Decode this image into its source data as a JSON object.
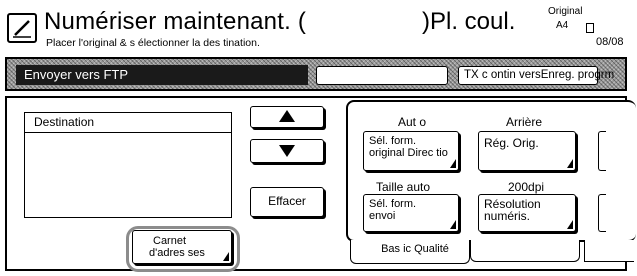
{
  "header": {
    "title": "Numériser maintenant. (",
    "subtitle": "Placer l'original & s électionner la des tination.",
    "title_right": ")Pl. coul.",
    "original_label": "Original",
    "original_size": "A4",
    "date": "08/08"
  },
  "bar": {
    "send_to": "Envoyer vers FTP",
    "right_button": "TX c ontin versEnreg. progrm"
  },
  "destination": {
    "label": "Destination"
  },
  "buttons": {
    "effacer": "Effacer",
    "carnet_line1": "Carnet",
    "carnet_line2": "d'adres ses"
  },
  "settings": {
    "auto_label": "Aut o",
    "arriere_label": "Arrière",
    "sel_form_orig_line1": "Sél. form.",
    "sel_form_orig_line2": "original Direc tio",
    "reg_orig": "Rég. Orig.",
    "taille_label": "Taille auto",
    "dpi_label": "200dpi",
    "sel_form_envoi_line1": "Sél. form.",
    "sel_form_envoi_line2": "envoi",
    "resolution_line1": "Résolution",
    "resolution_line2": "numéris."
  },
  "tabs": {
    "basic": "Bas ic Qualité"
  }
}
